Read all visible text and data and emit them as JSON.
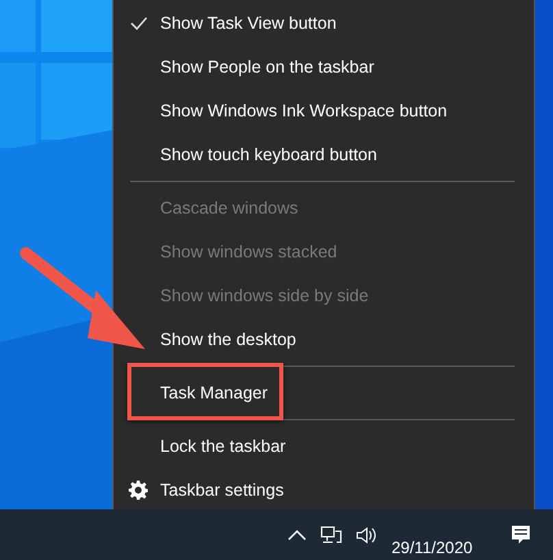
{
  "menu": {
    "items": [
      {
        "kind": "item",
        "label": "Show Task View button",
        "checked": true,
        "disabled": false,
        "highlighted": false
      },
      {
        "kind": "item",
        "label": "Show People on the taskbar",
        "checked": false,
        "disabled": false,
        "highlighted": false
      },
      {
        "kind": "item",
        "label": "Show Windows Ink Workspace button",
        "checked": false,
        "disabled": false,
        "highlighted": false
      },
      {
        "kind": "item",
        "label": "Show touch keyboard button",
        "checked": false,
        "disabled": false,
        "highlighted": false
      },
      {
        "kind": "separator"
      },
      {
        "kind": "item",
        "label": "Cascade windows",
        "checked": false,
        "disabled": true,
        "highlighted": false
      },
      {
        "kind": "item",
        "label": "Show windows stacked",
        "checked": false,
        "disabled": true,
        "highlighted": false
      },
      {
        "kind": "item",
        "label": "Show windows side by side",
        "checked": false,
        "disabled": true,
        "highlighted": false
      },
      {
        "kind": "item",
        "label": "Show the desktop",
        "checked": false,
        "disabled": false,
        "highlighted": false
      },
      {
        "kind": "separator"
      },
      {
        "kind": "item",
        "label": "Task Manager",
        "checked": false,
        "disabled": false,
        "highlighted": true
      },
      {
        "kind": "separator"
      },
      {
        "kind": "item",
        "label": "Lock the taskbar",
        "checked": false,
        "disabled": false,
        "highlighted": false
      },
      {
        "kind": "gear",
        "label": "Taskbar settings",
        "checked": false,
        "disabled": false,
        "highlighted": false
      }
    ]
  },
  "taskbar": {
    "date": "29/11/2020"
  }
}
